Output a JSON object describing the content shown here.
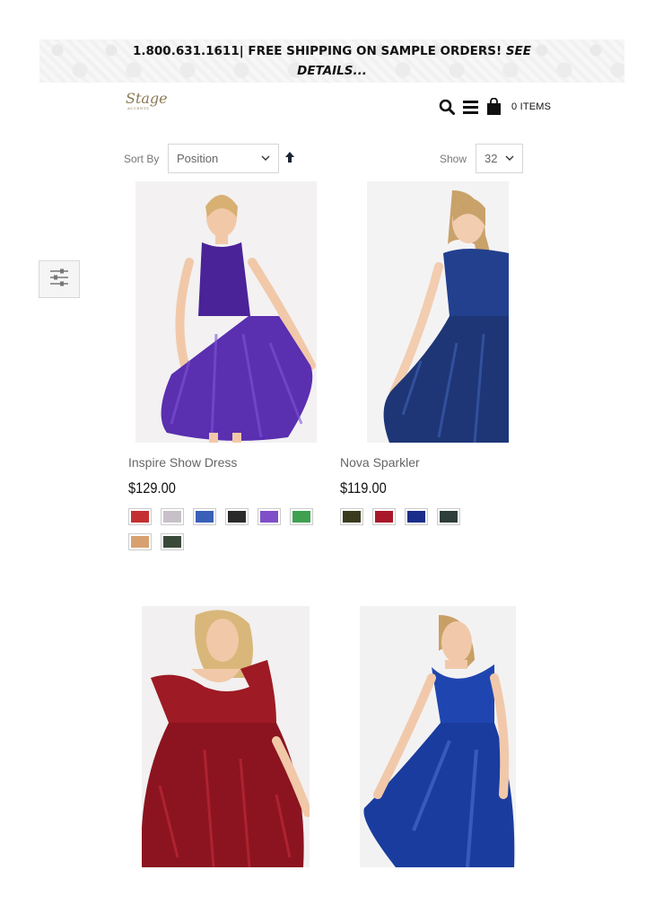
{
  "promo": {
    "phone": "1.800.631.1611",
    "separator": "|",
    "message": " FREE SHIPPING ON SAMPLE ORDERS! ",
    "see": "SEE",
    "details": "DETAILS..."
  },
  "logo": {
    "name": "Stage",
    "sub": "ACCENTS"
  },
  "header": {
    "cart_count": "0 ITEMS"
  },
  "toolbar": {
    "sort_label": "Sort By",
    "sort_value": "Position",
    "show_label": "Show",
    "show_value": "32"
  },
  "icons": [
    "search-icon",
    "menu-icon",
    "shopping-bag-icon",
    "chevron-down-icon",
    "arrow-up-icon",
    "filter-sliders-icon"
  ],
  "products": [
    {
      "name": "Inspire Show Dress",
      "price": "$129.00",
      "image_desc_color": "#5a2fb0",
      "swatches": [
        "#c43030",
        "#c8c0c8",
        "#3a5fb8",
        "#2a2a2a",
        "#7e4fc8",
        "#3fa050",
        "#d8a070",
        "#3a4a3a"
      ]
    },
    {
      "name": "Nova Sparkler",
      "price": "$119.00",
      "image_desc_color": "#22408e",
      "swatches": [
        "#3a3a1e",
        "#a8182a",
        "#1a2e8a",
        "#2e3e3a"
      ]
    },
    {
      "name": "",
      "price": "",
      "image_desc_color": "#9e1a24",
      "swatches": []
    },
    {
      "name": "",
      "price": "",
      "image_desc_color": "#1f46b0",
      "swatches": []
    }
  ]
}
